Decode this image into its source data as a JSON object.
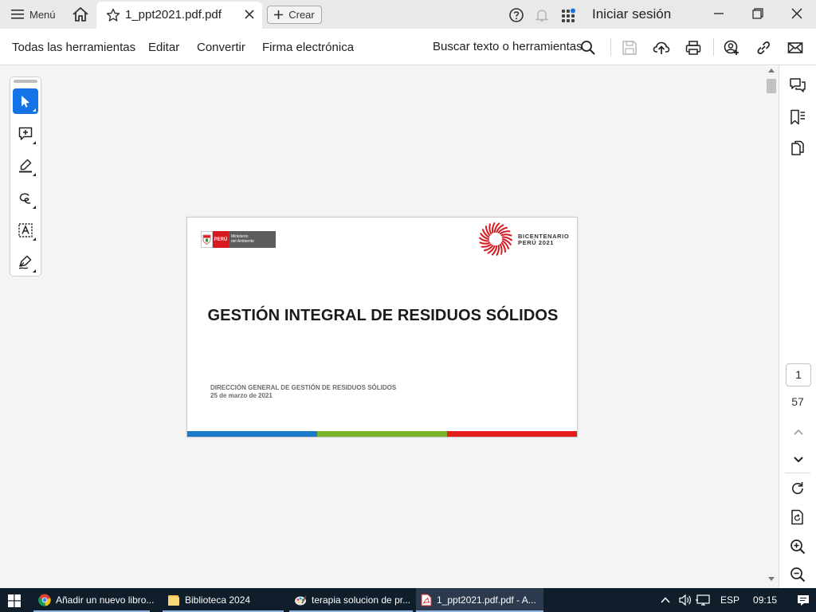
{
  "titlebar": {
    "menu_label": "Menú",
    "tab_title": "1_ppt2021.pdf.pdf",
    "create_label": "Crear",
    "signin_label": "Iniciar sesión"
  },
  "menubar": {
    "items": [
      "Todas las herramientas",
      "Editar",
      "Convertir",
      "Firma electrónica"
    ],
    "search_label": "Buscar texto o herramientas"
  },
  "document": {
    "logo_left": {
      "country": "PERÚ",
      "ministry_line1": "Ministerio",
      "ministry_line2": "del Ambiente"
    },
    "logo_right": {
      "line1": "BICENTENARIO",
      "line2": "PERÚ 2021"
    },
    "title": "GESTIÓN INTEGRAL DE RESIDUOS SÓLIDOS",
    "subtitle": "DIRECCIÓN GENERAL DE GESTIÓN DE RESIDUOS SÓLIDOS",
    "date": "25 de marzo de 2021",
    "stripe_colors": [
      "#1a7ac8",
      "#78b42b",
      "#e41c1c"
    ]
  },
  "navigation": {
    "current_page": "1",
    "total_pages": "57"
  },
  "taskbar": {
    "items": [
      {
        "label": "Añadir un nuevo libro..."
      },
      {
        "label": "Biblioteca 2024"
      },
      {
        "label": "terapia solucion de pr..."
      },
      {
        "label": "1_ppt2021.pdf.pdf - A..."
      }
    ],
    "language": "ESP",
    "time": "09:15"
  },
  "colors": {
    "accent": "#1473e6",
    "taskbar_bg": "#101d2b"
  }
}
